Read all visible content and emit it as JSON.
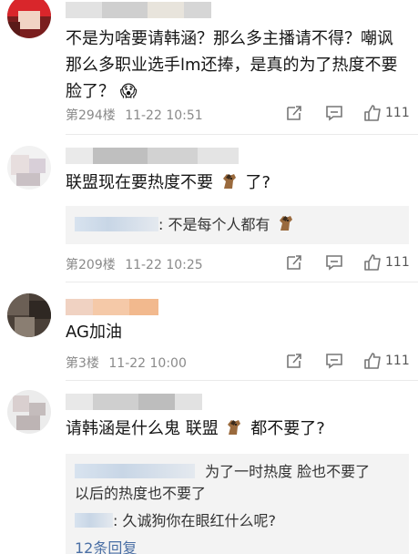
{
  "comments": [
    {
      "text": "不是为啥要请韩涵？那么多主播请不得？嘲讽那么多职业选手lm还捧，是真的为了热度不要脸了？",
      "emoji": "😱",
      "floor": "第294楼",
      "time": "11-22 10:51",
      "likes": "111"
    },
    {
      "text_before": "联盟现在要热度不要",
      "text_after": "了?",
      "reply": {
        "text_before": ": 不是每个人都有"
      },
      "floor": "第209楼",
      "time": "11-22 10:25",
      "likes": "111"
    },
    {
      "text": "AG加油",
      "floor": "第3楼",
      "time": "11-22 10:00",
      "likes": "111"
    },
    {
      "text_before": "请韩涵是什么鬼 联盟",
      "text_after": "都不要了?",
      "replies": [
        {
          "text_line1": "为了一时热度 脸也不要了",
          "text_line2": "以后的热度也不要了"
        },
        {
          "text": ": 久诚狗你在眼红什么呢?"
        }
      ],
      "partial": "12条回复"
    }
  ],
  "icons": {
    "share": "share-icon",
    "comment": "comment-icon",
    "like": "thumbs-up-icon",
    "emoji": "horse-emoji-icon"
  }
}
